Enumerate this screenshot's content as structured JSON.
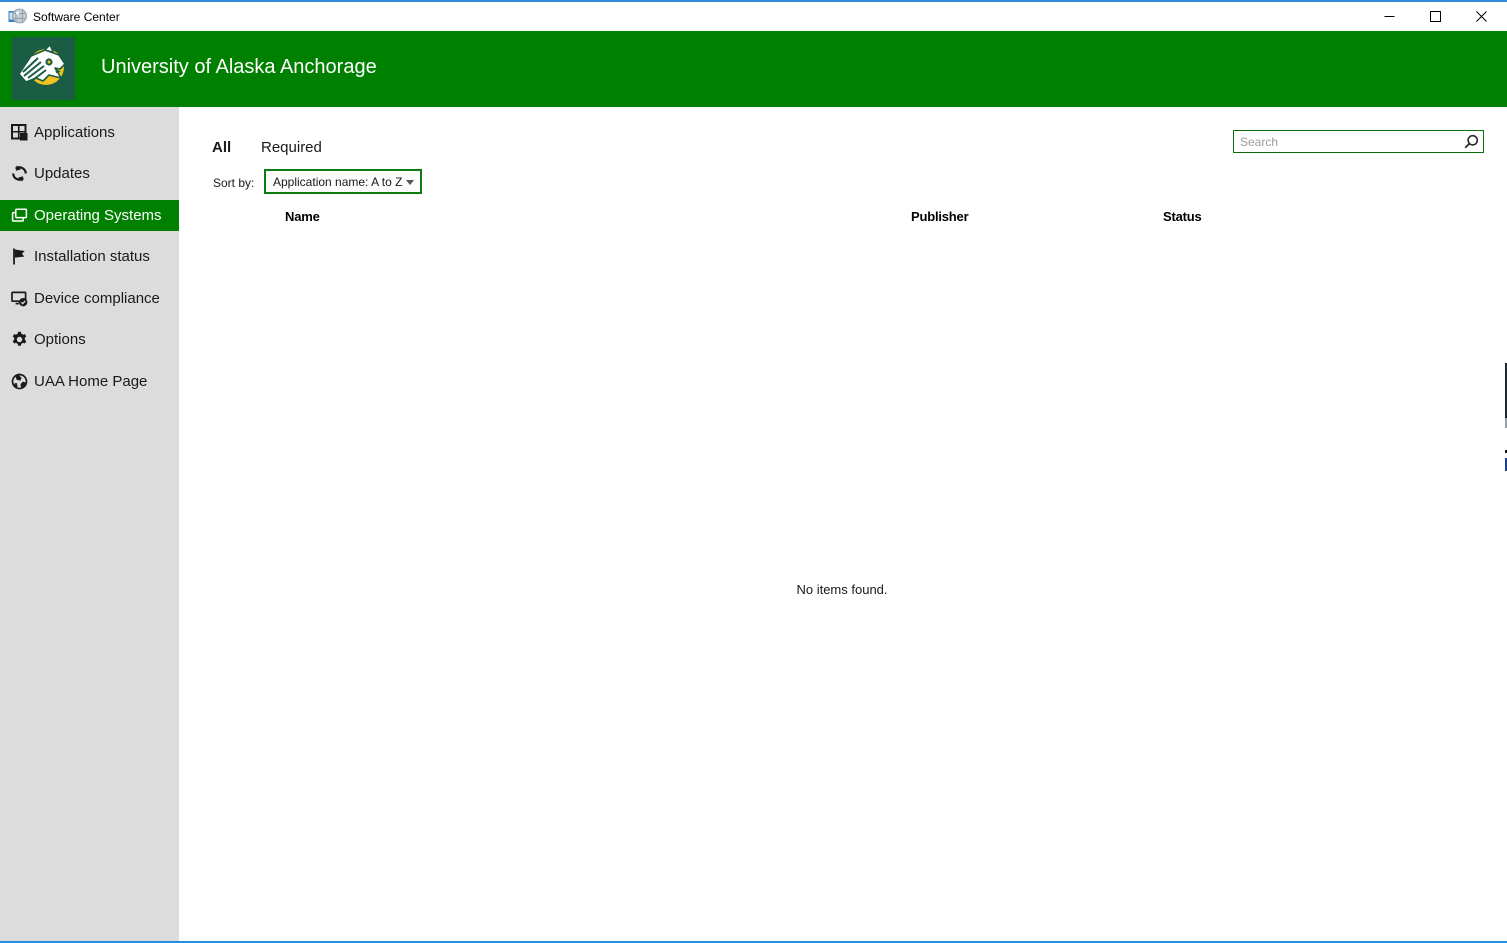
{
  "window": {
    "title": "Software Center",
    "controls": {
      "minimize": "minimize",
      "maximize": "maximize",
      "close": "close"
    }
  },
  "header": {
    "title": "University of Alaska Anchorage",
    "logo": "uaa-seawolf-logo"
  },
  "sidebar": {
    "items": [
      {
        "label": "Applications",
        "icon": "applications-icon",
        "selected": false
      },
      {
        "label": "Updates",
        "icon": "updates-icon",
        "selected": false
      },
      {
        "label": "Operating Systems",
        "icon": "operating-systems-icon",
        "selected": true
      },
      {
        "label": "Installation status",
        "icon": "installation-status-icon",
        "selected": false
      },
      {
        "label": "Device compliance",
        "icon": "device-compliance-icon",
        "selected": false
      },
      {
        "label": "Options",
        "icon": "options-icon",
        "selected": false
      },
      {
        "label": "UAA Home Page",
        "icon": "globe-icon",
        "selected": false
      }
    ]
  },
  "main": {
    "tabs": [
      {
        "label": "All",
        "selected": true
      },
      {
        "label": "Required",
        "selected": false
      }
    ],
    "search": {
      "placeholder": "Search",
      "value": ""
    },
    "sort": {
      "label": "Sort by:",
      "value": "Application name: A to Z"
    },
    "table": {
      "columns": [
        "Name",
        "Publisher",
        "Status"
      ]
    },
    "empty_message": "No items found."
  },
  "colors": {
    "header_green": "#008000",
    "selection_green": "#008000",
    "sidebar_gray": "#dcdcdc",
    "window_border_blue": "#2e8bd8",
    "search_border_green": "#0b6d0b",
    "dropdown_border_green": "#107c10",
    "uaa_gold": "#f2c31e",
    "logo_background": "#1b5c45"
  }
}
